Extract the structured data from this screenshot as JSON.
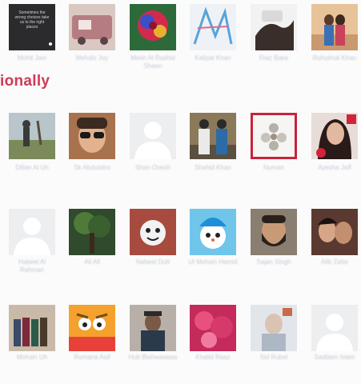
{
  "page": {
    "section_heading": "ionally"
  },
  "colors": {
    "accent": "#cf3a57",
    "selection_border": "#c8233a",
    "caption": "#c4cad4",
    "placeholder": "#eceef0"
  },
  "friends": [
    {
      "name": "Mohit Jain",
      "photo": "text-post-image",
      "photo_text": "Sometimes the wrong choices take us to the right places"
    },
    {
      "name": "Mehdiz Joy",
      "photo": "car-photo"
    },
    {
      "name": "Mesh Al Rashid Shaon",
      "photo": "rose-photo"
    },
    {
      "name": "Kalipal Khan",
      "photo": "sketch-photo"
    },
    {
      "name": "Riaz Bake",
      "photo": "hands-photo"
    },
    {
      "name": "Ruhulmal Khan",
      "photo": "couple-photo"
    },
    {
      "name": "Dillan Al Uh",
      "photo": "outdoor-photo"
    },
    {
      "name": "Sk Abdulatro",
      "photo": "sunglasses-selfie-photo"
    },
    {
      "name": "Shan Ovesh",
      "photo": "default-avatar-icon"
    },
    {
      "name": "Shahid Khan",
      "photo": "two-men-photo"
    },
    {
      "name": "Numan",
      "photo": "flower-art-photo",
      "selected": true
    },
    {
      "name": "Ayesha Jeff",
      "photo": "woman-portrait-photo"
    },
    {
      "name": "Habeel Al Rahman",
      "photo": "default-avatar-icon"
    },
    {
      "name": "Ali All",
      "photo": "tree-photo"
    },
    {
      "name": "Nabeel Dutt",
      "photo": "sticker-photo"
    },
    {
      "name": "Ul Mohsin Hamid",
      "photo": "snowman-photo"
    },
    {
      "name": "Sajan Singh",
      "photo": "bearded-man-photo"
    },
    {
      "name": "Alib Zafar",
      "photo": "selfie-couple-photo"
    },
    {
      "name": "Mohsin Uh",
      "photo": "group-photo"
    },
    {
      "name": "Rumana Asif",
      "photo": "cartoon-face-photo"
    },
    {
      "name": "Hub Bishwaswas",
      "photo": "man-portrait-photo"
    },
    {
      "name": "Khalid Raaz",
      "photo": "pink-flowers-photo"
    },
    {
      "name": "Sid Rubel",
      "photo": "bright-portrait-photo"
    },
    {
      "name": "Saddam Islam",
      "photo": "default-avatar-icon"
    }
  ]
}
